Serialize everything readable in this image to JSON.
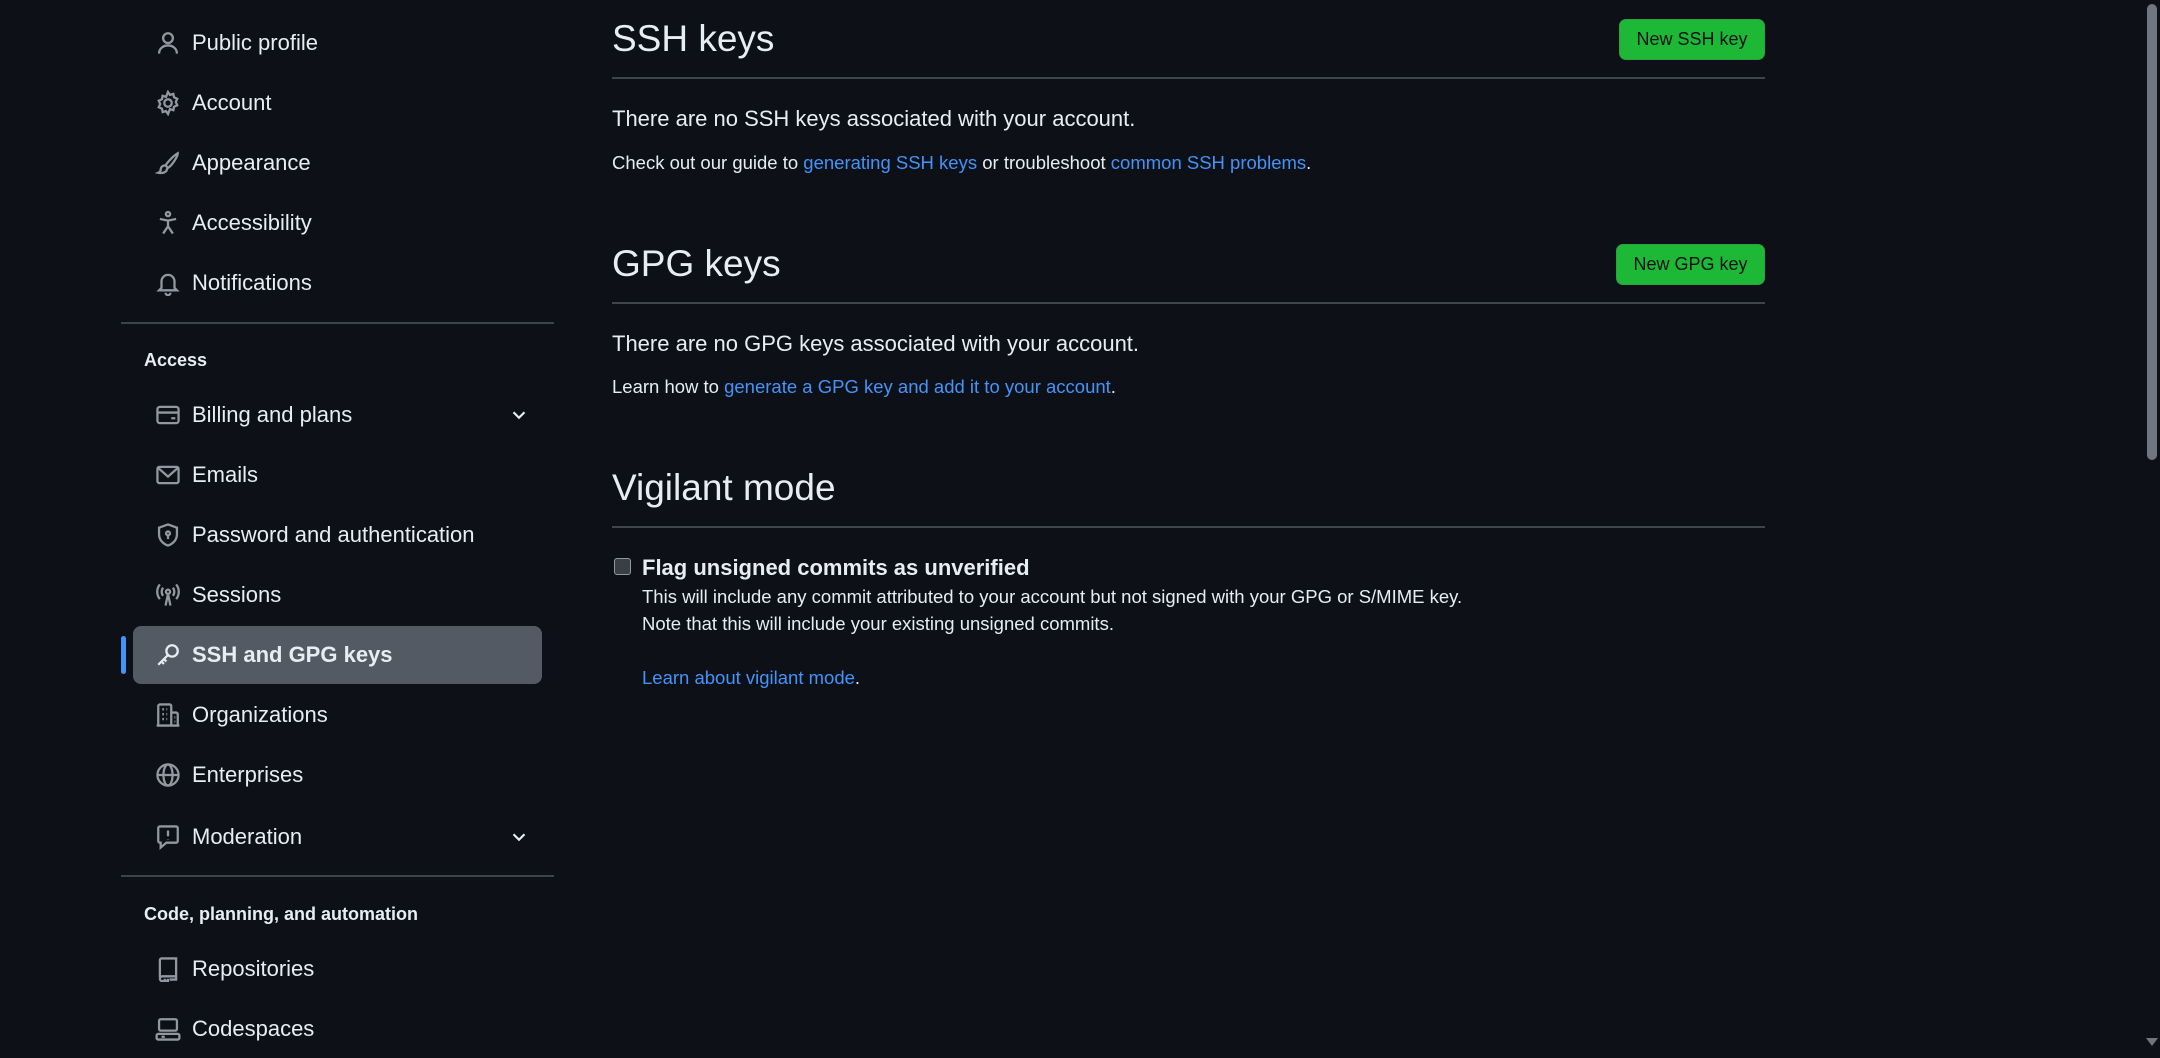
{
  "sidebar": {
    "top_items": [
      {
        "label": "Public profile",
        "icon": "person-icon"
      },
      {
        "label": "Account",
        "icon": "gear-icon"
      },
      {
        "label": "Appearance",
        "icon": "paintbrush-icon"
      },
      {
        "label": "Accessibility",
        "icon": "accessibility-icon"
      },
      {
        "label": "Notifications",
        "icon": "bell-icon"
      }
    ],
    "access_label": "Access",
    "access_items": [
      {
        "label": "Billing and plans",
        "icon": "credit-card-icon",
        "expandable": true
      },
      {
        "label": "Emails",
        "icon": "mail-icon"
      },
      {
        "label": "Password and authentication",
        "icon": "shield-lock-icon"
      },
      {
        "label": "Sessions",
        "icon": "broadcast-icon"
      },
      {
        "label": "SSH and GPG keys",
        "icon": "key-icon",
        "active": true
      },
      {
        "label": "Organizations",
        "icon": "organization-icon"
      },
      {
        "label": "Enterprises",
        "icon": "globe-icon"
      },
      {
        "label": "Moderation",
        "icon": "report-icon",
        "expandable": true
      }
    ],
    "code_label": "Code, planning, and automation",
    "code_items": [
      {
        "label": "Repositories",
        "icon": "repo-icon"
      },
      {
        "label": "Codespaces",
        "icon": "codespaces-icon"
      }
    ]
  },
  "ssh": {
    "title": "SSH keys",
    "button": "New SSH key",
    "empty": "There are no SSH keys associated with your account.",
    "guide_prefix": "Check out our guide to ",
    "guide_link1": "generating SSH keys",
    "guide_middle": " or troubleshoot ",
    "guide_link2": "common SSH problems",
    "guide_suffix": "."
  },
  "gpg": {
    "title": "GPG keys",
    "button": "New GPG key",
    "empty": "There are no GPG keys associated with your account.",
    "learn_prefix": "Learn how to ",
    "learn_link": "generate a GPG key and add it to your account",
    "learn_suffix": "."
  },
  "vigilant": {
    "title": "Vigilant mode",
    "checkbox_label": "Flag unsigned commits as unverified",
    "checked": false,
    "desc1": "This will include any commit attributed to your account but not signed with your GPG or S/MIME key.",
    "desc2": "Note that this will include your existing unsigned commits.",
    "learn_link": "Learn about vigilant mode",
    "learn_suffix": "."
  },
  "colors": {
    "background": "#0d1117",
    "accent": "#4493f8",
    "button_green": "#1db936",
    "active_item": "#535a64"
  }
}
